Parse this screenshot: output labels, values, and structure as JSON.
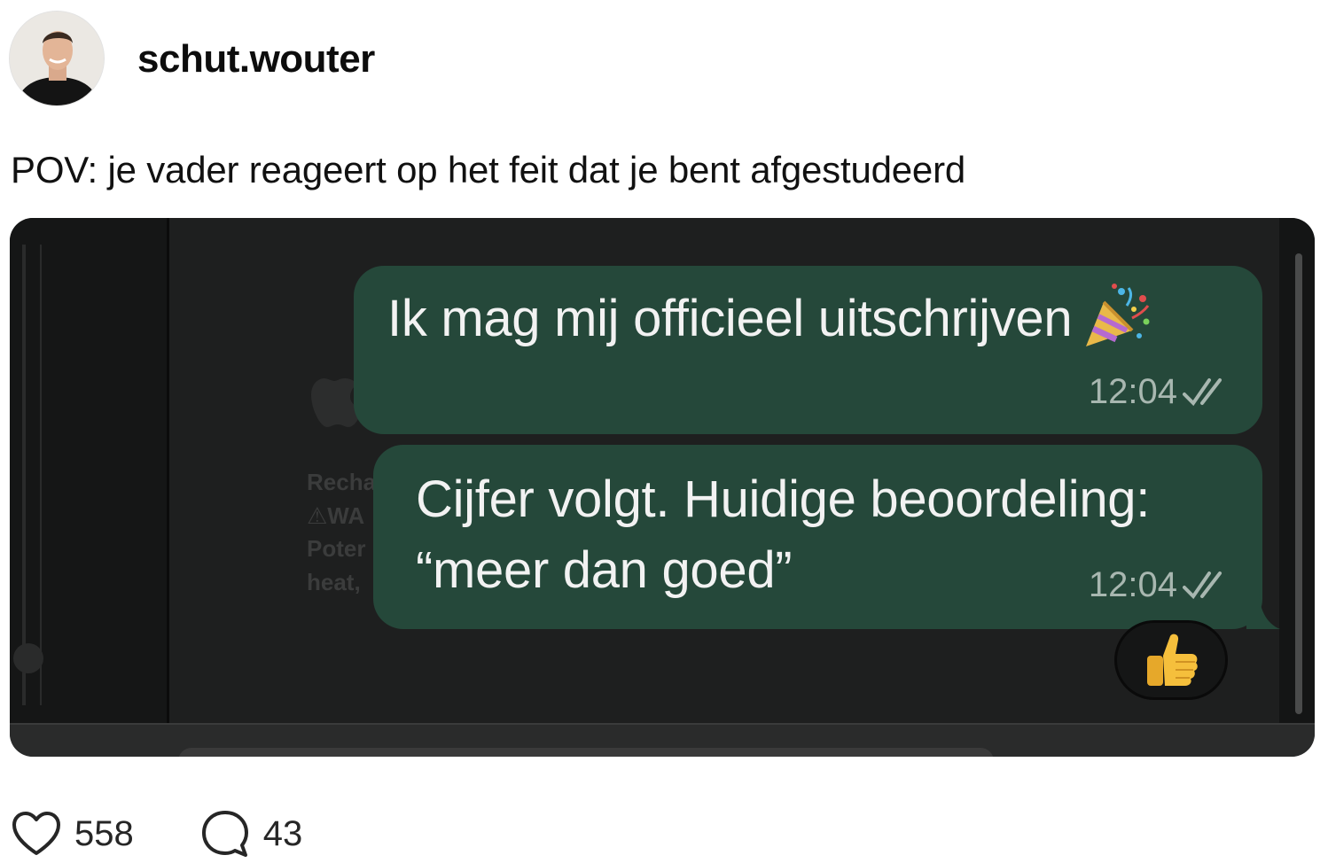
{
  "post": {
    "username": "schut.wouter",
    "caption": "POV: je vader reageert op het feit dat je bent afgestudeerd"
  },
  "chat": {
    "messages": [
      {
        "text": "Ik mag mij officieel uitschrijven",
        "emoji": "party-popper-icon",
        "time": "12:04",
        "status": "read"
      },
      {
        "text_line1": "Cijfer volgt. Huidige beoordeling:",
        "text_line2": "“meer dan goed”",
        "time": "12:04",
        "status": "read"
      }
    ],
    "reaction": "thumbs-up-icon",
    "background_text": [
      "Recha",
      "⚠WA",
      "Poter",
      "heat,"
    ]
  },
  "stats": {
    "likes": "558",
    "comments": "43"
  },
  "colors": {
    "bubble": "#25483a",
    "chat_bg": "#1e1f1f",
    "timestamp": "#a8b7b0"
  }
}
